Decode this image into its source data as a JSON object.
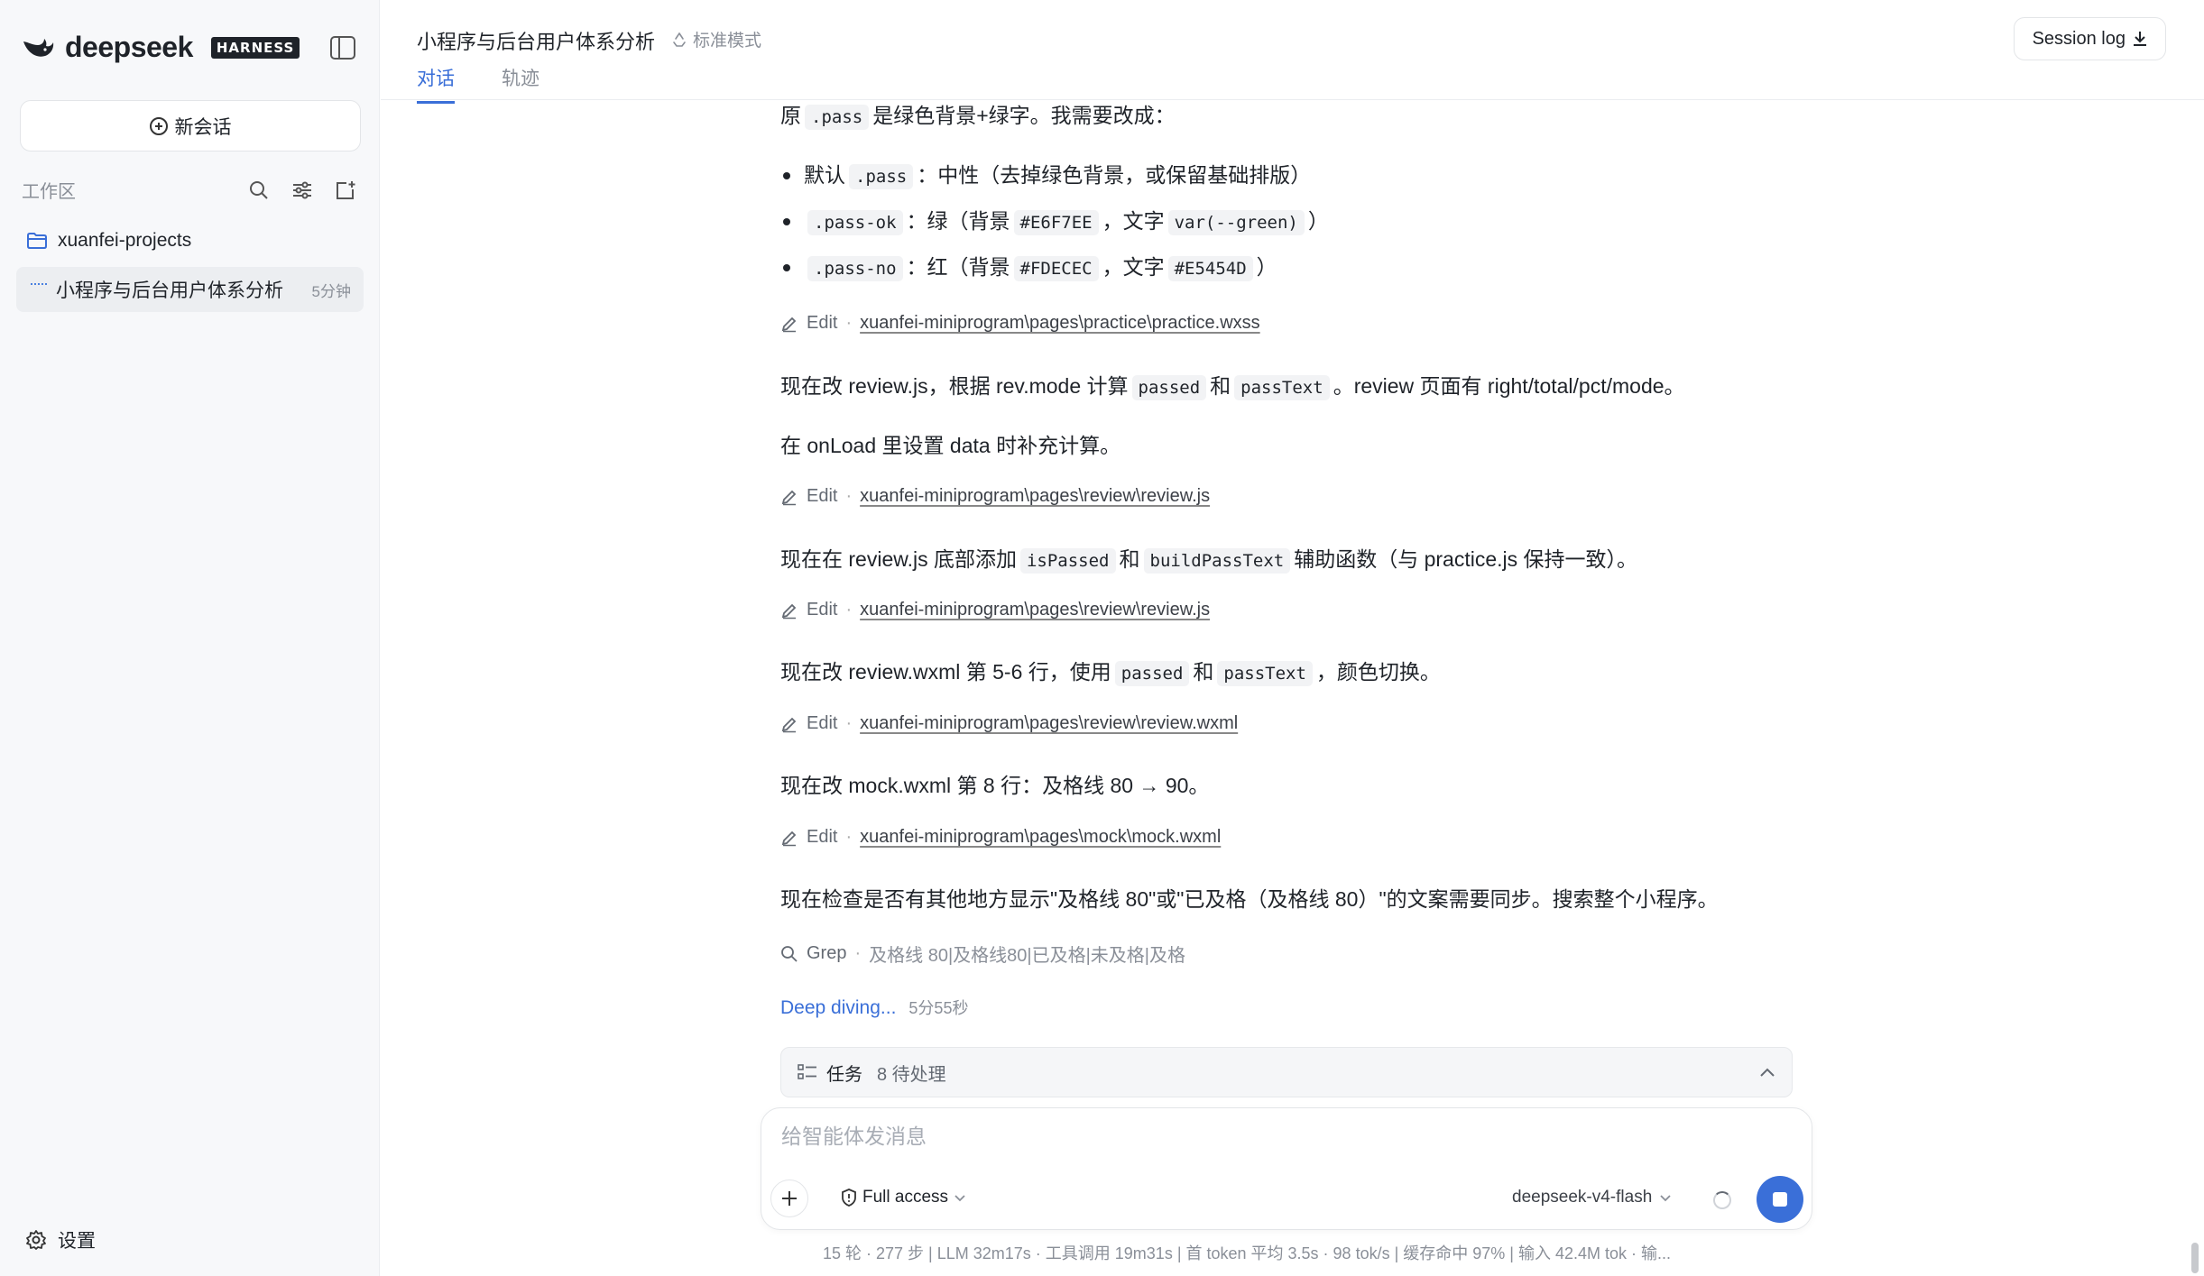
{
  "sidebar": {
    "brand_name": "deepseek",
    "brand_badge": "HARNESS",
    "new_chat_label": "新会话",
    "workspace_label": "工作区",
    "folder_name": "xuanfei-projects",
    "session": {
      "title": "小程序与后台用户体系分析",
      "time": "5分钟"
    },
    "settings_label": "设置"
  },
  "header": {
    "title": "小程序与后台用户体系分析",
    "mode": "标准模式",
    "tabs": [
      {
        "label": "对话",
        "active": true
      },
      {
        "label": "轨迹",
        "active": false
      }
    ],
    "session_log_label": "Session log"
  },
  "messages": {
    "m1": {
      "pre": "原",
      "code1": ".pass",
      "post": "是绿色背景+绿字。我需要改成："
    },
    "bullets": [
      {
        "code1": ".pass",
        "text1": "默认",
        "text2": "：中性（去掉绿色背景，或保留基础排版）"
      },
      {
        "code1": ".pass-ok",
        "text2": "：绿（背景",
        "code2": "#E6F7EE",
        "text3": "，文字",
        "code3": "var(--green)",
        "text4": "）"
      },
      {
        "code1": ".pass-no",
        "text2": "：红（背景",
        "code2": "#FDECEC",
        "text3": "，文字",
        "code3": "#E5454D",
        "text4": "）"
      }
    ],
    "m2": {
      "pre": "现在改 review.js，根据 rev.mode 计算",
      "code1": "passed",
      "mid": "和",
      "code2": "passText",
      "post": "。review 页面有 right/total/pct/mode。"
    },
    "m3": "在 onLoad 里设置 data 时补充计算。",
    "m4": {
      "pre": "现在在 review.js 底部添加",
      "code1": "isPassed",
      "mid": "和",
      "code2": "buildPassText",
      "post": "辅助函数（与 practice.js 保持一致）。"
    },
    "m5": {
      "pre": "现在改 review.wxml 第 5-6 行，使用",
      "code1": "passed",
      "mid": "和",
      "code2": "passText",
      "post": "，颜色切换。"
    },
    "m6": "现在改 mock.wxml 第 8 行：及格线 80 → 90。",
    "m7": "现在检查是否有其他地方显示\"及格线 80\"或\"已及格（及格线 80）\"的文案需要同步。搜索整个小程序。"
  },
  "tools": [
    {
      "action": "Edit",
      "target": "xuanfei-miniprogram\\pages\\practice\\practice.wxss",
      "icon": "pencil-icon"
    },
    {
      "action": "Edit",
      "target": "xuanfei-miniprogram\\pages\\review\\review.js",
      "icon": "pencil-icon"
    },
    {
      "action": "Edit",
      "target": "xuanfei-miniprogram\\pages\\review\\review.js",
      "icon": "pencil-icon"
    },
    {
      "action": "Edit",
      "target": "xuanfei-miniprogram\\pages\\review\\review.wxml",
      "icon": "pencil-icon"
    },
    {
      "action": "Edit",
      "target": "xuanfei-miniprogram\\pages\\mock\\mock.wxml",
      "icon": "pencil-icon"
    },
    {
      "action": "Grep",
      "target": "及格线 80|及格线80|已及格|未及格|及格",
      "icon": "search-icon"
    }
  ],
  "status": {
    "deep_label": "Deep diving...",
    "deep_time": "5分55秒"
  },
  "tasks": {
    "label": "任务",
    "count": "8 待处理"
  },
  "composer": {
    "placeholder": "给智能体发消息",
    "access_label": "Full access",
    "model_label": "deepseek-v4-flash"
  },
  "stats_line": "15 轮 · 277 步   |   LLM 32m17s · 工具调用 19m31s   |   首 token 平均 3.5s · 98 tok/s   |   缓存命中 97%   |   输入 42.4M tok · 输...",
  "colors": {
    "accent": "#3a6fd8",
    "sidebar_bg": "#f7f8fa",
    "code_bg": "#f2f3f5"
  }
}
